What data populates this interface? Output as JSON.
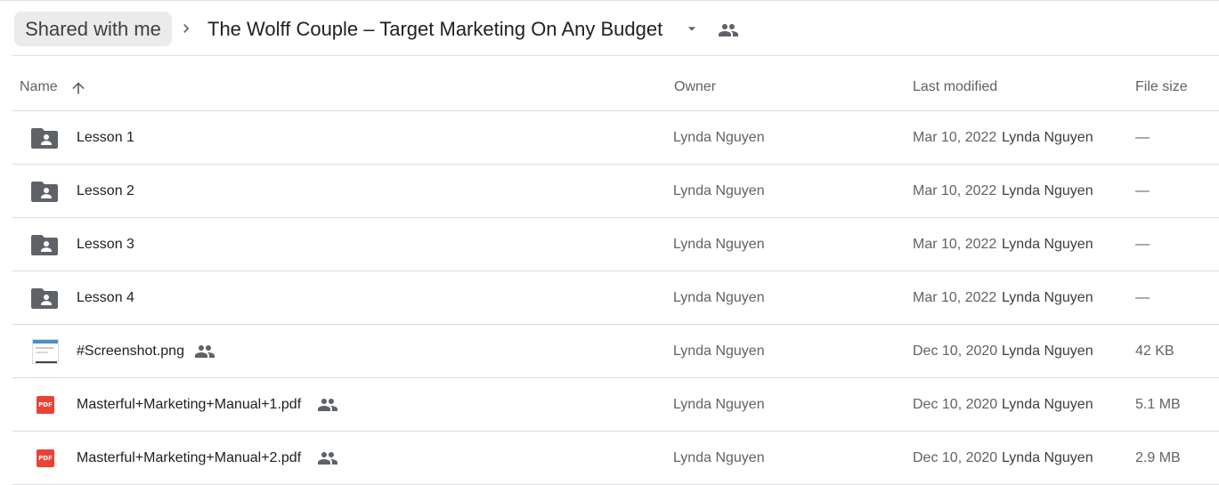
{
  "breadcrumb": {
    "shared_with_me": "Shared with me",
    "current_folder": "The Wolff Couple – Target Marketing On Any Budget"
  },
  "columns": {
    "name": "Name",
    "owner": "Owner",
    "last_modified": "Last modified",
    "file_size": "File size"
  },
  "files": [
    {
      "name": "Lesson 1",
      "type": "shared-folder",
      "owner": "Lynda Nguyen",
      "modified_date": "Mar 10, 2022",
      "modified_by": "Lynda Nguyen",
      "size": "—",
      "shared": false
    },
    {
      "name": "Lesson 2",
      "type": "shared-folder",
      "owner": "Lynda Nguyen",
      "modified_date": "Mar 10, 2022",
      "modified_by": "Lynda Nguyen",
      "size": "—",
      "shared": false
    },
    {
      "name": "Lesson 3",
      "type": "shared-folder",
      "owner": "Lynda Nguyen",
      "modified_date": "Mar 10, 2022",
      "modified_by": "Lynda Nguyen",
      "size": "—",
      "shared": false
    },
    {
      "name": "Lesson 4",
      "type": "shared-folder",
      "owner": "Lynda Nguyen",
      "modified_date": "Mar 10, 2022",
      "modified_by": "Lynda Nguyen",
      "size": "—",
      "shared": false
    },
    {
      "name": "#Screenshot.png",
      "type": "image",
      "owner": "Lynda Nguyen",
      "modified_date": "Dec 10, 2020",
      "modified_by": "Lynda Nguyen",
      "size": "42 KB",
      "shared": true
    },
    {
      "name": "Masterful+Marketing+Manual+1.pdf",
      "type": "pdf",
      "owner": "Lynda Nguyen",
      "modified_date": "Dec 10, 2020",
      "modified_by": "Lynda Nguyen",
      "size": "5.1 MB",
      "shared": true
    },
    {
      "name": "Masterful+Marketing+Manual+2.pdf",
      "type": "pdf",
      "owner": "Lynda Nguyen",
      "modified_date": "Dec 10, 2020",
      "modified_by": "Lynda Nguyen",
      "size": "2.9 MB",
      "shared": true
    }
  ],
  "icons": {
    "pdf_badge": "PDF",
    "folder_color": "#5f6368",
    "pdf_color": "#ea4335"
  }
}
